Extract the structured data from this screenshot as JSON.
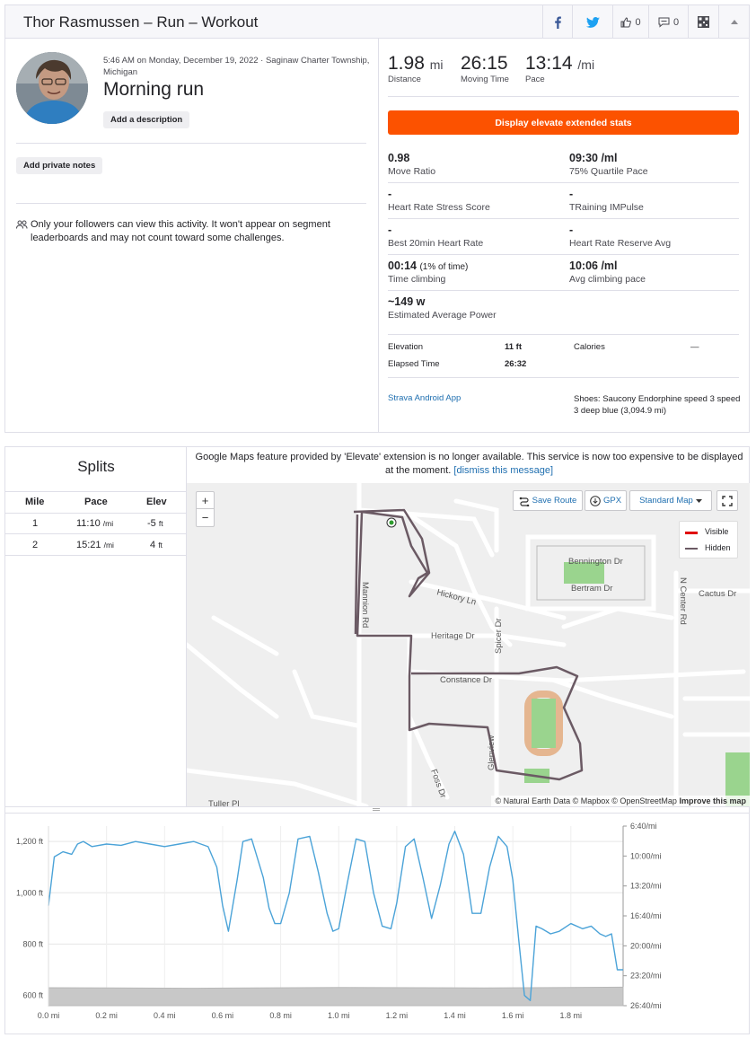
{
  "header": {
    "title": "Thor Rasmussen – Run – Workout",
    "kudos_count": "0",
    "comments_count": "0"
  },
  "activity": {
    "meta": "5:46 AM on Monday, December 19, 2022 · Saginaw Charter Township, Michigan",
    "name": "Morning run",
    "add_description": "Add a description",
    "add_private_notes": "Add private notes",
    "privacy_notice": "Only your followers can view this activity. It won't appear on segment leaderboards and may not count toward some challenges."
  },
  "stats": {
    "distance": {
      "value": "1.98",
      "unit": "mi",
      "label": "Distance"
    },
    "moving_time": {
      "value": "26:15",
      "label": "Moving Time"
    },
    "pace": {
      "value": "13:14",
      "unit": "/mi",
      "label": "Pace"
    },
    "elevate_button": "Display elevate extended stats",
    "grid": [
      {
        "left_value": "0.98",
        "left_label": "Move Ratio",
        "right_value": "09:30 /ml",
        "right_label": "75% Quartile Pace"
      },
      {
        "left_value": "-",
        "left_label": "Heart Rate Stress Score",
        "right_value": "-",
        "right_label": "TRaining IMPulse"
      },
      {
        "left_value": "-",
        "left_label": "Best 20min Heart Rate",
        "right_value": "-",
        "right_label": "Heart Rate Reserve Avg"
      },
      {
        "left_value": "00:14",
        "left_extra": "(1% of time)",
        "left_label": "Time climbing",
        "right_value": "10:06 /ml",
        "right_label": "Avg climbing pace"
      },
      {
        "left_value": "~149 w",
        "left_label": "Estimated Average Power"
      }
    ],
    "elevation_label": "Elevation",
    "elevation_value": "11 ft",
    "calories_label": "Calories",
    "calories_value": "—",
    "elapsed_label": "Elapsed Time",
    "elapsed_value": "26:32",
    "device": "Strava Android App",
    "shoes": "Shoes: Saucony Endorphine speed 3 speed 3 deep blue (3,094.9 mi)"
  },
  "splits": {
    "title": "Splits",
    "headers": [
      "Mile",
      "Pace",
      "Elev"
    ],
    "rows": [
      {
        "mile": "1",
        "pace": "11:10",
        "pace_unit": "/mi",
        "elev": "-5",
        "elev_unit": "ft"
      },
      {
        "mile": "2",
        "pace": "15:21",
        "pace_unit": "/mi",
        "elev": "4",
        "elev_unit": "ft"
      }
    ]
  },
  "map": {
    "notice": "Google Maps feature provided by 'Elevate' extension is no longer available. This service is now too expensive to be displayed at the moment.",
    "dismiss": "[dismiss this message]",
    "zoom_in": "+",
    "zoom_out": "−",
    "save_route": "Save Route",
    "gpx": "GPX",
    "map_type": "Standard Map",
    "legend_visible": "Visible",
    "legend_hidden": "Hidden",
    "attribution": "© Natural Earth Data © Mapbox © OpenStreetMap",
    "improve": "Improve this map",
    "streets": [
      "Bennington Dr",
      "Bertram Dr",
      "Hickory Ln",
      "Heritage Dr",
      "Constance Dr",
      "Spicer Dr",
      "N Center Rd",
      "Cactus Dr",
      "Mannion Rd",
      "Foss Dr",
      "Tuller Pl",
      "Glenview"
    ],
    "colors": {
      "route": "#6b5a64",
      "visible": "#e00000",
      "park": "#9ad48e"
    }
  },
  "chart_data": {
    "type": "area",
    "x_ticks": [
      "0.0 mi",
      "0.2 mi",
      "0.4 mi",
      "0.6 mi",
      "0.8 mi",
      "1.0 mi",
      "1.2 mi",
      "1.4 mi",
      "1.6 mi",
      "1.8 mi"
    ],
    "x_tick_values": [
      0,
      0.2,
      0.4,
      0.6,
      0.8,
      1.0,
      1.2,
      1.4,
      1.6,
      1.8
    ],
    "xlim": [
      0,
      1.98
    ],
    "y_left_ticks": [
      "1,200 ft",
      "1,000 ft",
      "800 ft",
      "600 ft"
    ],
    "y_left_tick_values": [
      1200,
      1000,
      800,
      600
    ],
    "y_right_ticks": [
      "6:40/mi",
      "10:00/mi",
      "13:20/mi",
      "16:40/mi",
      "20:00/mi",
      "23:20/mi",
      "26:40/mi"
    ],
    "series": [
      {
        "kind": "pace",
        "color": "#4ba3d8",
        "x": [
          0,
          0.02,
          0.05,
          0.08,
          0.1,
          0.12,
          0.15,
          0.2,
          0.25,
          0.3,
          0.35,
          0.4,
          0.45,
          0.5,
          0.55,
          0.58,
          0.6,
          0.62,
          0.65,
          0.67,
          0.7,
          0.74,
          0.76,
          0.78,
          0.8,
          0.83,
          0.86,
          0.9,
          0.93,
          0.96,
          0.98,
          1.0,
          1.03,
          1.06,
          1.09,
          1.12,
          1.15,
          1.18,
          1.2,
          1.23,
          1.26,
          1.29,
          1.32,
          1.35,
          1.38,
          1.4,
          1.43,
          1.46,
          1.49,
          1.52,
          1.55,
          1.58,
          1.6,
          1.62,
          1.64,
          1.66,
          1.68,
          1.7,
          1.73,
          1.76,
          1.8,
          1.84,
          1.87,
          1.9,
          1.92,
          1.94,
          1.96,
          1.98
        ],
        "y": [
          950,
          1140,
          1160,
          1150,
          1190,
          1200,
          1180,
          1190,
          1185,
          1200,
          1190,
          1180,
          1190,
          1200,
          1180,
          1100,
          950,
          850,
          1050,
          1200,
          1210,
          1060,
          940,
          880,
          880,
          1000,
          1210,
          1220,
          1080,
          920,
          850,
          860,
          1040,
          1210,
          1200,
          1000,
          870,
          860,
          960,
          1180,
          1210,
          1060,
          900,
          1030,
          1190,
          1240,
          1150,
          920,
          920,
          1100,
          1220,
          1180,
          1050,
          820,
          600,
          580,
          870,
          860,
          840,
          850,
          880,
          860,
          870,
          840,
          830,
          840,
          700,
          700
        ]
      },
      {
        "kind": "elevation",
        "color": "#c8c8c8",
        "x": [
          0,
          0.5,
          1.0,
          1.5,
          1.98
        ],
        "y": [
          630,
          628,
          631,
          629,
          632
        ]
      }
    ],
    "ylim": [
      560,
      1260
    ]
  }
}
